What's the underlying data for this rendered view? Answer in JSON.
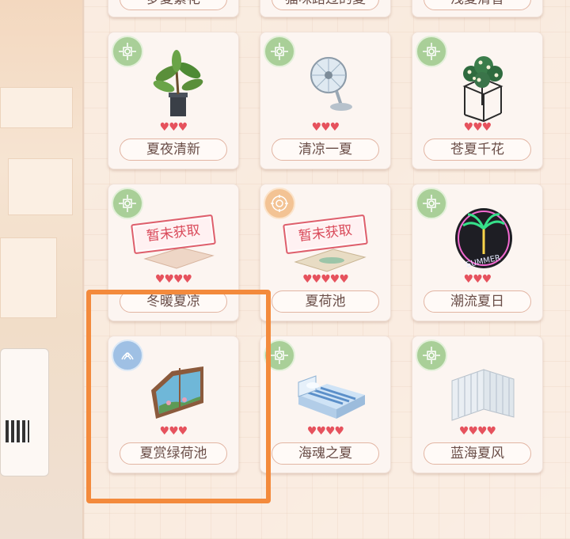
{
  "colors": {
    "heart": "#e6525d",
    "highlight": "#f38a3c",
    "badge_green": "#a9cf98",
    "badge_orange": "#f3c394",
    "badge_blue": "#9fc0e4",
    "name_text": "#6a4e48"
  },
  "top_row": [
    {
      "name": "梦夏繁花"
    },
    {
      "name": "猫咪路过的夏"
    },
    {
      "name": "浅夏清香"
    }
  ],
  "cards": [
    {
      "name": "夏夜清新",
      "hearts": "♥♥♥",
      "badge": "green",
      "icon": "potted-plant-icon"
    },
    {
      "name": "清凉一夏",
      "hearts": "♥♥♥",
      "badge": "green",
      "icon": "desk-fan-icon"
    },
    {
      "name": "苍夏千花",
      "hearts": "♥♥♥",
      "badge": "green",
      "icon": "flower-shelf-icon"
    },
    {
      "name": "冬暖夏凉",
      "hearts": "♥♥♥♥",
      "badge": "green",
      "icon": "rug-icon",
      "stamp": "暂未获取"
    },
    {
      "name": "夏荷池",
      "hearts": "♥♥♥♥♥",
      "badge": "orange",
      "icon": "pond-rug-icon",
      "stamp": "暂未获取"
    },
    {
      "name": "潮流夏日",
      "hearts": "♥♥♥",
      "badge": "green",
      "icon": "summer-neon-sign-icon"
    },
    {
      "name": "夏赏绿荷池",
      "hearts": "♥♥♥",
      "badge": "blue",
      "icon": "pond-window-icon"
    },
    {
      "name": "海魂之夏",
      "hearts": "♥♥♥♥",
      "badge": "green",
      "icon": "striped-bed-icon"
    },
    {
      "name": "蓝海夏风",
      "hearts": "♥♥♥♥",
      "badge": "green",
      "icon": "folding-screen-icon"
    }
  ],
  "neon_text": "SUMMER"
}
